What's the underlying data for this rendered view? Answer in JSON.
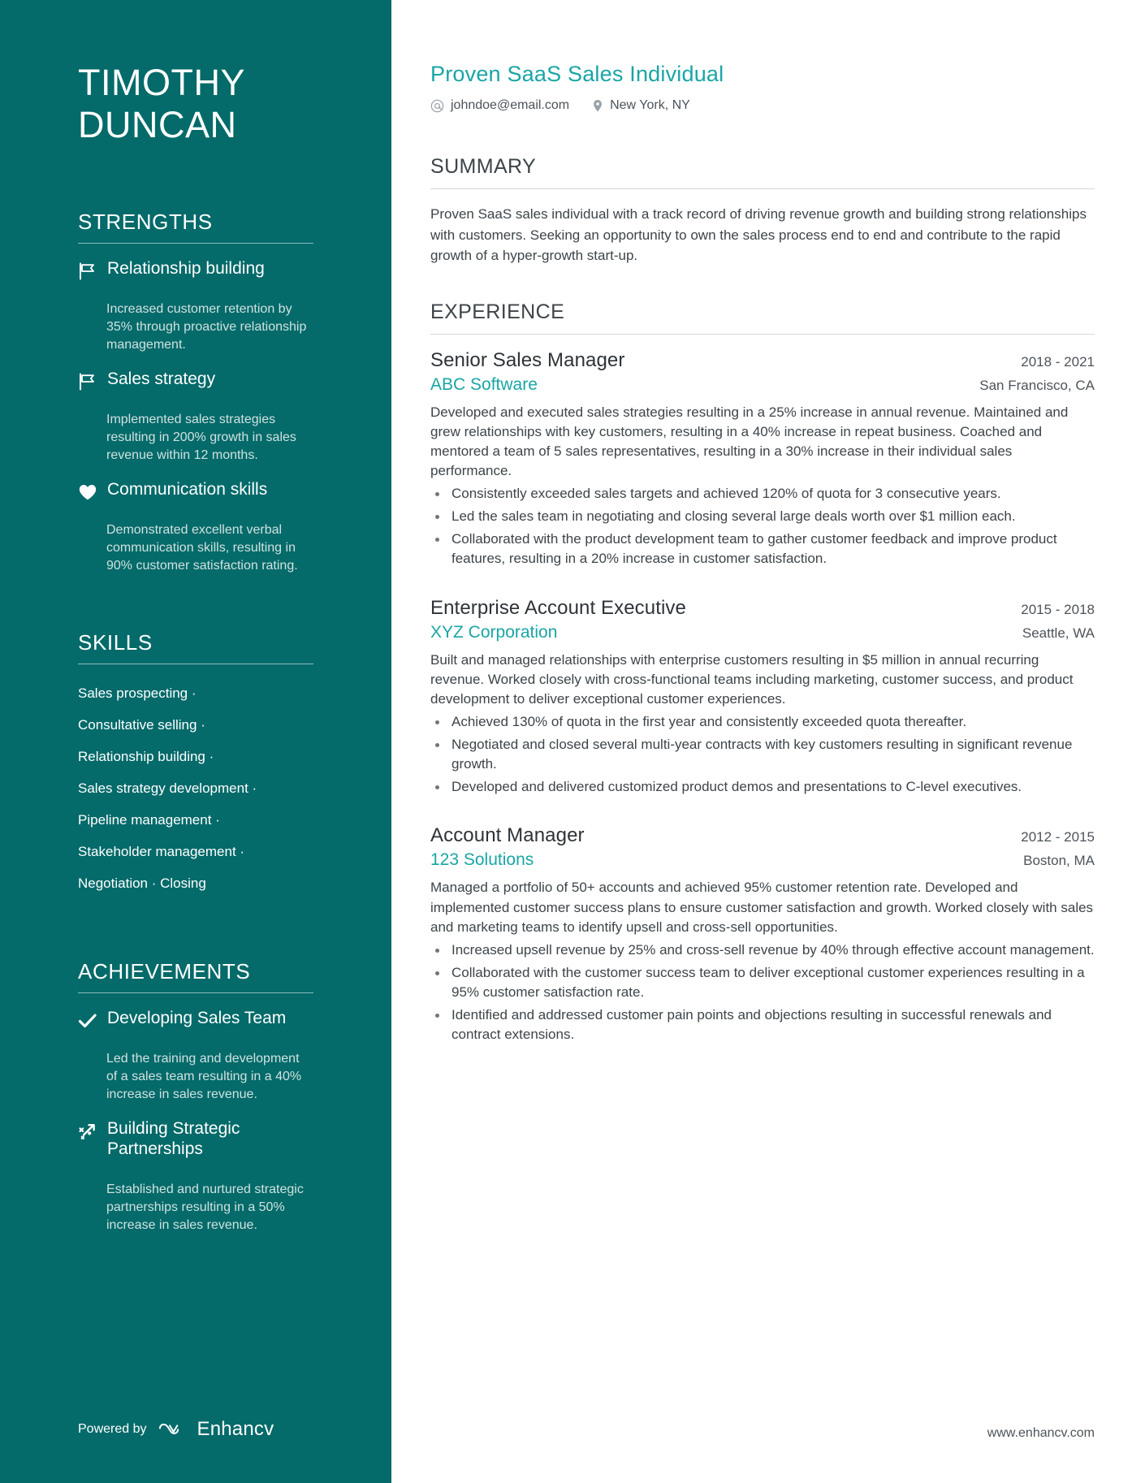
{
  "theme": {
    "sidebar_bg": "#046A6A",
    "accent": "#1aa5a5",
    "text": "#3d4449",
    "muted": "#cfe2e0"
  },
  "sidebar": {
    "name_first": "TIMOTHY",
    "name_last": "DUNCAN",
    "sections": {
      "strengths": {
        "title": "STRENGTHS",
        "items": [
          {
            "icon": "flag-icon",
            "title": "Relationship building",
            "desc": "Increased customer retention by 35% through proactive relationship management."
          },
          {
            "icon": "flag-icon",
            "title": "Sales strategy",
            "desc": "Implemented sales strategies resulting in 200% growth in sales revenue within 12 months."
          },
          {
            "icon": "heart-icon",
            "title": "Communication skills",
            "desc": "Demonstrated excellent verbal communication skills, resulting in 90% customer satisfaction rating."
          }
        ]
      },
      "skills": {
        "title": "SKILLS",
        "lines": [
          "Sales prospecting ·",
          "Consultative selling ·",
          "Relationship building ·",
          "Sales strategy development ·",
          "Pipeline management ·",
          "Stakeholder management ·",
          "Negotiation · Closing"
        ]
      },
      "achievements": {
        "title": "ACHIEVEMENTS",
        "items": [
          {
            "icon": "check-icon",
            "title": "Developing Sales Team",
            "desc": "Led the training and development of a sales team resulting in a 40% increase in sales revenue."
          },
          {
            "icon": "growth-arrow-icon",
            "title": "Building Strategic Partnerships",
            "desc": "Established and nurtured strategic partnerships resulting in a 50% increase in sales revenue."
          }
        ]
      }
    },
    "footer": {
      "powered_by": "Powered by",
      "brand": "Enhancv"
    }
  },
  "main": {
    "headline": "Proven SaaS Sales Individual",
    "contact": {
      "email_icon": "at-sign-icon",
      "email": "johndoe@email.com",
      "location_icon": "map-pin-icon",
      "location": "New York, NY"
    },
    "summary": {
      "title": "SUMMARY",
      "text": "Proven SaaS sales individual with a track record of driving revenue growth and building strong relationships with customers. Seeking an opportunity to own the sales process end to end and contribute to the rapid growth of a hyper-growth start-up."
    },
    "experience": {
      "title": "EXPERIENCE",
      "jobs": [
        {
          "title": "Senior Sales Manager",
          "dates": "2018 - 2021",
          "company": "ABC Software",
          "location": "San Francisco, CA",
          "desc": "Developed and executed sales strategies resulting in a 25% increase in annual revenue. Maintained and grew relationships with key customers, resulting in a 40% increase in repeat business. Coached and mentored a team of 5 sales representatives, resulting in a 30% increase in their individual sales performance.",
          "bullets": [
            "Consistently exceeded sales targets and achieved 120% of quota for 3 consecutive years.",
            "Led the sales team in negotiating and closing several large deals worth over $1 million each.",
            "Collaborated with the product development team to gather customer feedback and improve product features, resulting in a 20% increase in customer satisfaction."
          ]
        },
        {
          "title": "Enterprise Account Executive",
          "dates": "2015 - 2018",
          "company": "XYZ Corporation",
          "location": "Seattle, WA",
          "desc": "Built and managed relationships with enterprise customers resulting in $5 million in annual recurring revenue. Worked closely with cross-functional teams including marketing, customer success, and product development to deliver exceptional customer experiences.",
          "bullets": [
            "Achieved 130% of quota in the first year and consistently exceeded quota thereafter.",
            "Negotiated and closed several multi-year contracts with key customers resulting in significant revenue growth.",
            "Developed and delivered customized product demos and presentations to C-level executives."
          ]
        },
        {
          "title": "Account Manager",
          "dates": "2012 - 2015",
          "company": "123 Solutions",
          "location": "Boston, MA",
          "desc": "Managed a portfolio of 50+ accounts and achieved 95% customer retention rate. Developed and implemented customer success plans to ensure customer satisfaction and growth. Worked closely with sales and marketing teams to identify upsell and cross-sell opportunities.",
          "bullets": [
            "Increased upsell revenue by 25% and cross-sell revenue by 40% through effective account management.",
            "Collaborated with the customer success team to deliver exceptional customer experiences resulting in a 95% customer satisfaction rate.",
            "Identified and addressed customer pain points and objections resulting in successful renewals and contract extensions."
          ]
        }
      ]
    },
    "footer_url": "www.enhancv.com"
  }
}
